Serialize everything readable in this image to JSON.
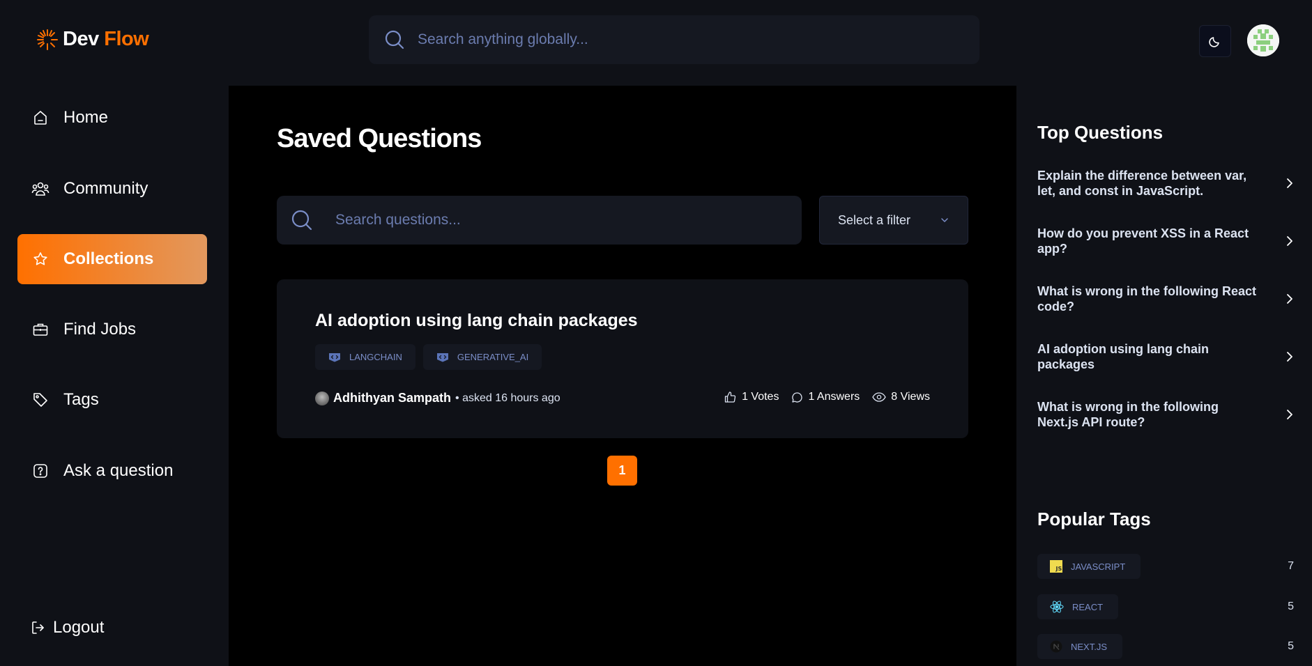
{
  "header": {
    "logo": {
      "word1": "Dev",
      "word2": "Flow",
      "icon": "sunburst-logo-icon"
    },
    "search_placeholder": "Search anything globally...",
    "theme_icon": "moon-icon",
    "avatar_icon": "user-avatar-icon"
  },
  "sidebar": {
    "items": [
      {
        "label": "Home",
        "icon": "home-icon",
        "active": false
      },
      {
        "label": "Community",
        "icon": "users-icon",
        "active": false
      },
      {
        "label": "Collections",
        "icon": "star-icon",
        "active": true
      },
      {
        "label": "Find Jobs",
        "icon": "briefcase-icon",
        "active": false
      },
      {
        "label": "Tags",
        "icon": "tag-icon",
        "active": false
      },
      {
        "label": "Ask a question",
        "icon": "question-icon",
        "active": false
      }
    ],
    "logout_label": "Logout"
  },
  "main": {
    "title": "Saved Questions",
    "search_placeholder": "Search questions...",
    "filter_label": "Select a filter",
    "questions": [
      {
        "title": "AI adoption using lang chain packages",
        "tags": [
          "langchain",
          "generative_ai"
        ],
        "author": "Adhithyan Sampath",
        "asked": "• asked 16 hours ago",
        "votes": "1 Votes",
        "answers": "1 Answers",
        "views": "8 Views"
      }
    ],
    "pagination": {
      "current": "1"
    }
  },
  "right_sidebar": {
    "top_questions_title": "Top Questions",
    "top_questions": [
      "Explain the difference between var, let, and const in JavaScript.",
      "How do you prevent XSS in a React app?",
      "What is wrong in the following React code?",
      "AI adoption using lang chain packages",
      "What is wrong in the following Next.js API route?"
    ],
    "popular_tags_title": "Popular Tags",
    "popular_tags": [
      {
        "name": "javascript",
        "count": "7",
        "icon": "javascript-icon"
      },
      {
        "name": "react",
        "count": "5",
        "icon": "react-icon"
      },
      {
        "name": "next.js",
        "count": "5",
        "icon": "nextjs-icon"
      }
    ]
  },
  "colors": {
    "accent": "#ff7000",
    "accent_gradient_end": "#e2985e",
    "panel": "#0f1117",
    "input": "#151821",
    "tag_text": "#7b8ec8"
  }
}
